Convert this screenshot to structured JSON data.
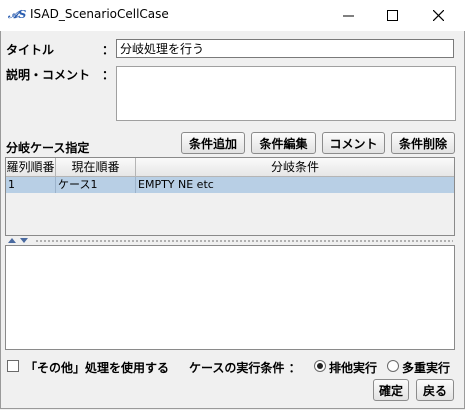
{
  "window": {
    "title": "ISAD_ScenarioCellCase",
    "icon": "isad-app-icon",
    "controls": [
      "minimize-icon",
      "maximize-icon",
      "close-icon"
    ]
  },
  "form": {
    "title_label": "タイトル",
    "desc_label": "説明・コメント",
    "colon": "：",
    "title_value": "分岐処理を行う",
    "desc_value": ""
  },
  "case_section": {
    "label": "分岐ケース指定",
    "buttons": {
      "add": "条件追加",
      "edit": "条件編集",
      "comment": "コメント",
      "delete": "条件削除"
    }
  },
  "table": {
    "columns": [
      "羅列順番",
      "現在順番",
      "分岐条件"
    ],
    "rows": [
      {
        "order": "1",
        "current": "ケース1",
        "condition": "EMPTY NE etc",
        "selected": true
      }
    ]
  },
  "footer": {
    "other_checkbox_label": "「その他」処理を使用する",
    "other_checked": false,
    "exec_label": "ケースの実行条件 ：",
    "radio_exclusive": "排他実行",
    "radio_multiple": "多重実行",
    "selected_mode": "排他実行",
    "confirm": "確定",
    "back": "戻る"
  },
  "colors": {
    "selection": "#b8cfe5",
    "app_icon": "#2a5db0"
  }
}
